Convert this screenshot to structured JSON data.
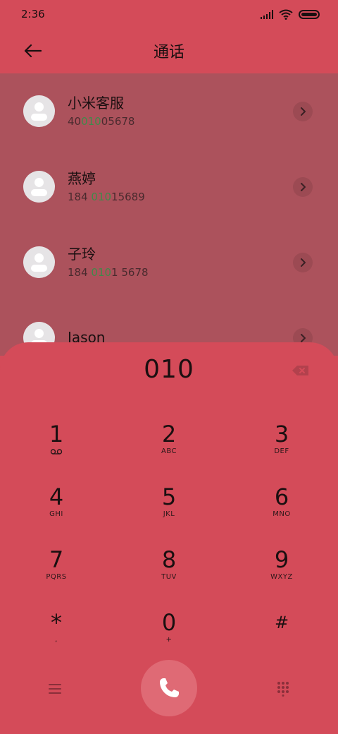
{
  "status_bar": {
    "time": "2:36"
  },
  "header": {
    "title": "通话"
  },
  "contacts": [
    {
      "name": "小米客服",
      "number_pre": "40",
      "number_match": "010",
      "number_post": "05678"
    },
    {
      "name": "燕婷",
      "number_pre": "184 ",
      "number_match": "010",
      "number_post": "15689"
    },
    {
      "name": "子玲",
      "number_pre": "184 ",
      "number_match": "010",
      "number_post": "1 5678"
    },
    {
      "name": "Jason",
      "number_pre": "",
      "number_match": "",
      "number_post": ""
    }
  ],
  "dialer": {
    "input": "010",
    "keys": [
      {
        "digit": "1",
        "letters": ""
      },
      {
        "digit": "2",
        "letters": "ABC"
      },
      {
        "digit": "3",
        "letters": "DEF"
      },
      {
        "digit": "4",
        "letters": "GHI"
      },
      {
        "digit": "5",
        "letters": "JKL"
      },
      {
        "digit": "6",
        "letters": "MNO"
      },
      {
        "digit": "7",
        "letters": "PQRS"
      },
      {
        "digit": "8",
        "letters": "TUV"
      },
      {
        "digit": "9",
        "letters": "WXYZ"
      },
      {
        "digit": "*",
        "letters": ","
      },
      {
        "digit": "0",
        "letters": "+"
      },
      {
        "digit": "#",
        "letters": ""
      }
    ]
  },
  "icons": {
    "back": "back-arrow-icon",
    "backspace": "backspace-icon",
    "voicemail": "voicemail-icon",
    "menu": "menu-icon",
    "call": "phone-icon",
    "keypad": "keypad-icon",
    "chevron": "chevron-right-icon"
  },
  "colors": {
    "background": "#d44b59",
    "list_overlay": "#ac525c",
    "match_highlight": "#3f8a4a",
    "call_button": "#df6a75"
  }
}
